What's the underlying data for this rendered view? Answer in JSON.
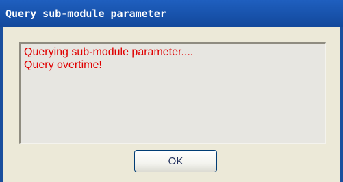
{
  "window": {
    "title": "Query sub-module parameter"
  },
  "message": {
    "lines": [
      "Querying sub-module parameter....",
      "Query overtime!"
    ],
    "text_color": "#e00000"
  },
  "buttons": {
    "ok_label": "OK"
  },
  "colors": {
    "titlebar": "#1a4f9e",
    "dialog_body": "#ece9d8"
  }
}
